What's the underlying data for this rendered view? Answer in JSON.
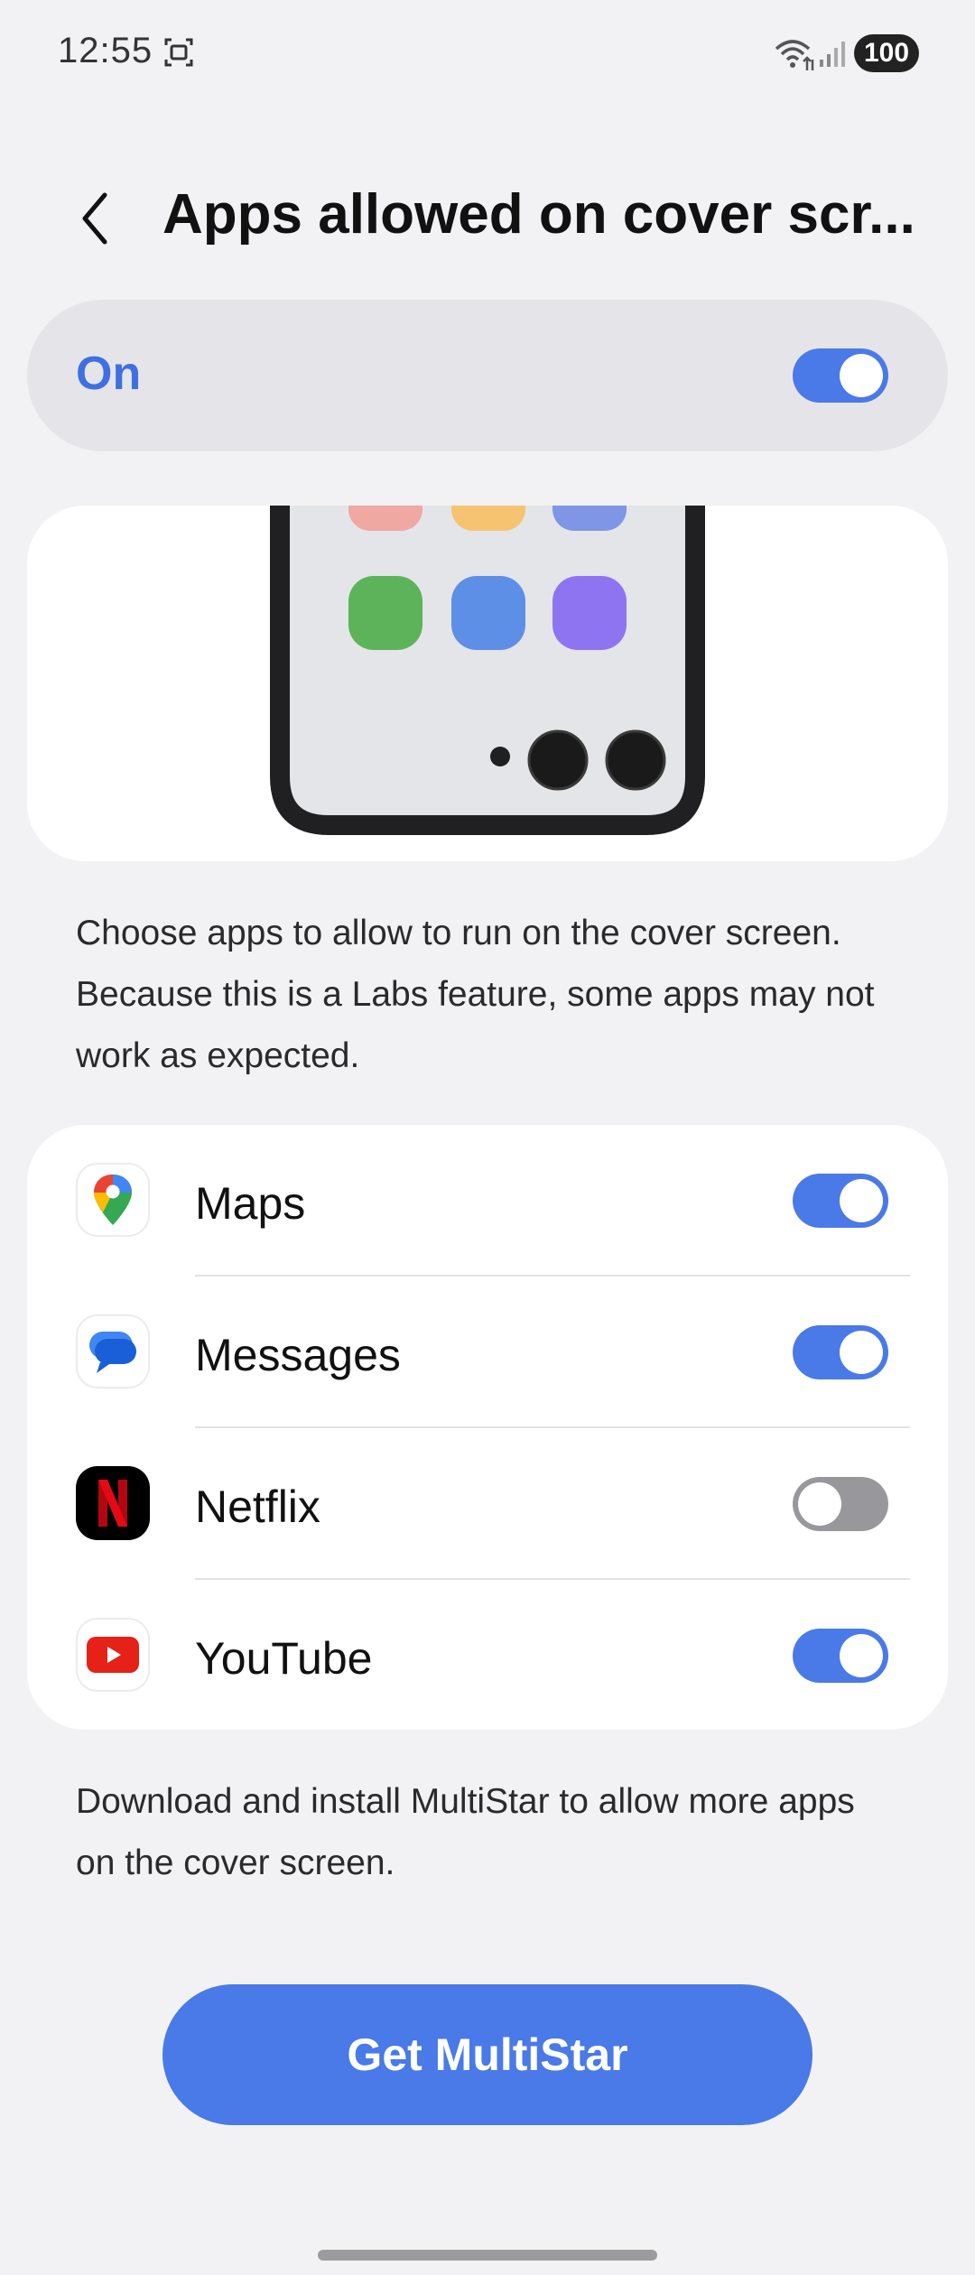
{
  "status_bar": {
    "time": "12:55",
    "battery": "100"
  },
  "header": {
    "title": "Apps allowed on cover scr..."
  },
  "master_toggle": {
    "label": "On",
    "state": true
  },
  "description": "Choose apps to allow to run on the cover screen. Because this is a Labs feature, some apps may not work as expected.",
  "apps": [
    {
      "name": "Maps",
      "icon": "google-maps-icon",
      "enabled": true
    },
    {
      "name": "Messages",
      "icon": "google-messages-icon",
      "enabled": true
    },
    {
      "name": "Netflix",
      "icon": "netflix-icon",
      "enabled": false
    },
    {
      "name": "YouTube",
      "icon": "youtube-icon",
      "enabled": true
    }
  ],
  "footer_text": "Download and install MultiStar to allow more apps on the cover screen.",
  "get_button_label": "Get MultiStar",
  "colors": {
    "accent": "#4a79e8",
    "switch_off": "#98989c",
    "background": "#f2f2f4"
  }
}
